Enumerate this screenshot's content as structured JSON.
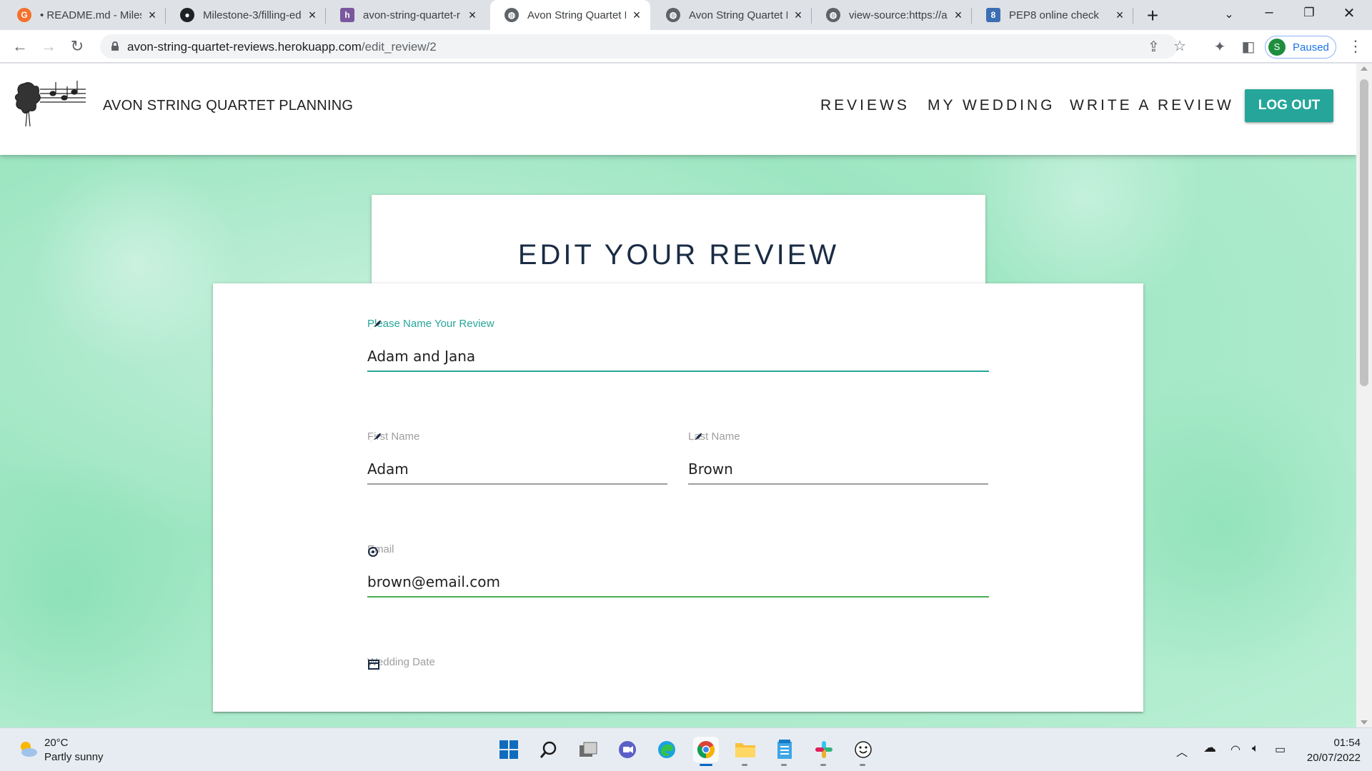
{
  "browser": {
    "tabs": [
      {
        "title": "• README.md - Miles",
        "favicon": "g-icon",
        "color": "#f4712c",
        "active": false
      },
      {
        "title": "Milestone-3/filling-ed",
        "favicon": "github-icon",
        "color": "#202124",
        "active": false
      },
      {
        "title": "avon-string-quartet-r",
        "favicon": "heroku-icon",
        "color": "#79589f",
        "active": false
      },
      {
        "title": "Avon String Quartet P",
        "favicon": "globe-icon",
        "color": "#5f6368",
        "active": true
      },
      {
        "title": "Avon String Quartet P",
        "favicon": "globe-icon",
        "color": "#5f6368",
        "active": false
      },
      {
        "title": "view-source:https://a",
        "favicon": "globe-icon",
        "color": "#5f6368",
        "active": false
      },
      {
        "title": "PEP8 online check",
        "favicon": "pep8-icon",
        "color": "#3c6eb4",
        "active": false
      }
    ],
    "url_host": "avon-string-quartet-reviews.herokuapp.com",
    "url_path": "/edit_review/2",
    "profile_initial": "S",
    "profile_status": "Paused"
  },
  "site": {
    "brand": "AVON STRING QUARTET PLANNING",
    "nav": {
      "reviews": "REVIEWS",
      "my_wedding": "MY WEDDING",
      "write_review": "WRITE A REVIEW",
      "logout": "LOG OUT"
    },
    "accent": "#26a69a",
    "page_title": "EDIT YOUR REVIEW"
  },
  "form": {
    "review_name": {
      "label": "Please Name Your Review",
      "value": "Adam and Jana"
    },
    "first_name": {
      "label": "First Name",
      "value": "Adam"
    },
    "last_name": {
      "label": "Last Name",
      "value": "Brown"
    },
    "email": {
      "label": "Email",
      "value": "brown@email.com"
    },
    "wedding_date": {
      "label": "Wedding Date"
    }
  },
  "taskbar": {
    "temperature": "20°C",
    "weather": "Partly sunny",
    "time": "01:54",
    "date": "20/07/2022"
  }
}
